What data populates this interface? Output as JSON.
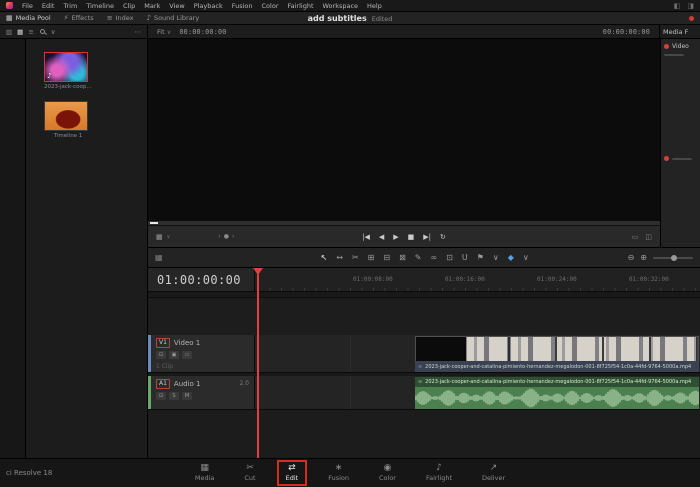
{
  "menu": {
    "items": [
      "File",
      "Edit",
      "Trim",
      "Timeline",
      "Clip",
      "Mark",
      "View",
      "Playback",
      "Fusion",
      "Color",
      "Fairlight",
      "Workspace",
      "Help"
    ],
    "right_icons": [
      {
        "name": "layout-left-icon",
        "glyph": "◧"
      },
      {
        "name": "layout-right-icon",
        "glyph": "◨"
      }
    ]
  },
  "titlebar": {
    "project_title": "add subtitles",
    "project_status": "Edited"
  },
  "panel_bar": {
    "media_pool": {
      "icon": "▦",
      "label": "Media Pool"
    },
    "effects": {
      "icon": "⚡",
      "label": "Effects"
    },
    "index": {
      "icon": "≡",
      "label": "Index"
    },
    "sound_library": {
      "icon": "♪",
      "label": "Sound Library"
    }
  },
  "media_pool_toolbar": {
    "icons": [
      {
        "name": "import-media-icon",
        "glyph": "▥"
      },
      {
        "name": "thumbnail-view-button",
        "glyph": "▦",
        "active": true
      },
      {
        "name": "list-view-button",
        "glyph": "≡"
      }
    ],
    "sort_caret": "∨",
    "more": "⋯"
  },
  "viewer_bar": {
    "fit_label": "Fit",
    "caret": "∨",
    "timecode": "00:00:00:00",
    "duration": "00:00:00:00"
  },
  "right_panel": {
    "title": "Media F",
    "section": "Video"
  },
  "media_pool": {
    "clips": [
      {
        "label": "2023-jack-cooper-...",
        "type": "audio-clip"
      },
      {
        "label": "Timeline 1",
        "type": "timeline"
      }
    ]
  },
  "transport": {
    "source_icon": "▦",
    "source_caret": "∨",
    "jog": [
      {
        "name": "jog-back-button",
        "glyph": "‹"
      },
      {
        "name": "jog-dot",
        "glyph": "●"
      },
      {
        "name": "jog-forward-button",
        "glyph": "›"
      }
    ],
    "buttons": [
      {
        "name": "go-to-start-button",
        "glyph": "|◀"
      },
      {
        "name": "step-back-button",
        "glyph": "◀"
      },
      {
        "name": "play-button",
        "glyph": "▶"
      },
      {
        "name": "stop-button",
        "glyph": "■"
      },
      {
        "name": "step-forward-button",
        "glyph": "▶|"
      },
      {
        "name": "loop-button",
        "glyph": "↻"
      }
    ],
    "right_icons": [
      {
        "name": "cinema-viewer-icon",
        "glyph": "▭"
      },
      {
        "name": "expand-viewer-icon",
        "glyph": "◫"
      }
    ]
  },
  "timeline_toolbar": {
    "timeline_select_icon": "▦",
    "tools": [
      {
        "name": "selection-mode-tool",
        "glyph": "↖",
        "active": true
      },
      {
        "name": "trim-edit-mode-tool",
        "glyph": "↔"
      },
      {
        "name": "razor-tool",
        "glyph": "✂"
      },
      {
        "name": "insert-clip-button",
        "glyph": "⊞"
      },
      {
        "name": "overwrite-clip-button",
        "glyph": "⊟"
      },
      {
        "name": "replace-clip-button",
        "glyph": "⊠"
      },
      {
        "name": "curve-editor-button",
        "glyph": "✎"
      },
      {
        "name": "linked-selection-button",
        "glyph": "∞"
      },
      {
        "name": "position-lock-button",
        "glyph": "⊡"
      },
      {
        "name": "snapping-button",
        "glyph": "U"
      },
      {
        "name": "flag-button",
        "glyph": "⚑"
      },
      {
        "name": "flag-dropdown",
        "glyph": "∨"
      },
      {
        "name": "marker-button",
        "glyph": "◆",
        "color": "#5aa0e8"
      },
      {
        "name": "marker-dropdown",
        "glyph": "∨"
      }
    ],
    "zoom_out": "⊖",
    "zoom_in": "⊕"
  },
  "timeline": {
    "timecode": "01:00:00:00",
    "ruler_labels": [
      "01:00:08:00",
      "01:00:16:00",
      "01:00:24:00",
      "01:00:32:00"
    ],
    "tracks": {
      "video": {
        "badge": "V1",
        "name": "Video 1",
        "clip_count": "1 Clip",
        "icons": [
          {
            "name": "lock-icon",
            "glyph": "⊡"
          },
          {
            "name": "auto-select-icon",
            "glyph": "▣"
          },
          {
            "name": "track-enable-icon",
            "glyph": "▭"
          }
        ]
      },
      "audio": {
        "badge": "A1",
        "name": "Audio 1",
        "channels": "2.0",
        "icons": [
          {
            "name": "lock-icon",
            "glyph": "⊡"
          },
          {
            "name": "solo-button",
            "glyph": "S"
          },
          {
            "name": "mute-button",
            "glyph": "M"
          }
        ]
      }
    },
    "clips": {
      "link_glyph": "∞",
      "video_filename": "2023-jack-cooper-and-catalina-pimiento-hernandez-megalodon-001-8f725f54-1c0a-44fd-9764-5000a.mp4",
      "audio_filename": "2023-jack-cooper-and-catalina-pimiento-hernandez-megalodon-001-8f725f54-1c0a-44fd-9764-5000a.mp4"
    }
  },
  "pages": {
    "items": [
      {
        "label": "Media",
        "icon": "▦"
      },
      {
        "label": "Cut",
        "icon": "✂"
      },
      {
        "label": "Edit",
        "icon": "⇄"
      },
      {
        "label": "Fusion",
        "icon": "∗"
      },
      {
        "label": "Color",
        "icon": "◉"
      },
      {
        "label": "Fairlight",
        "icon": "♪"
      },
      {
        "label": "Deliver",
        "icon": "↗"
      }
    ],
    "active": "Edit"
  },
  "statusbar": {
    "left": "ci Resolve 18"
  }
}
